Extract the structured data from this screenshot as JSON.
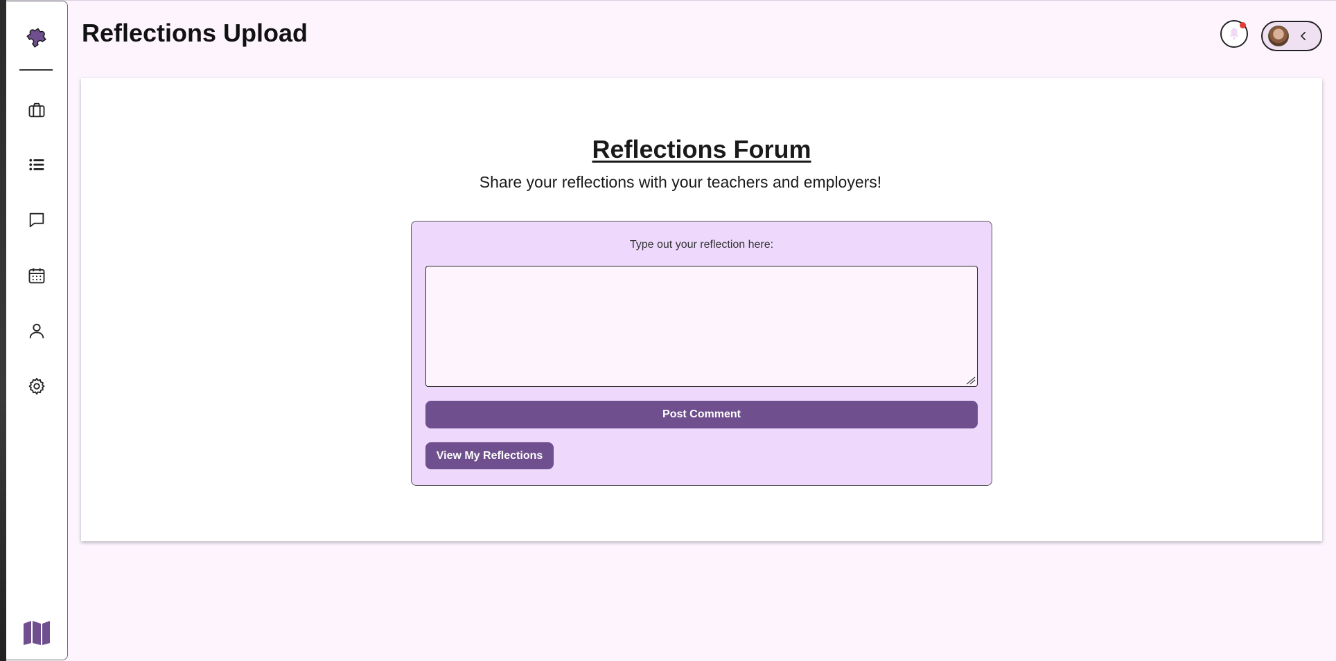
{
  "header": {
    "title": "Reflections Upload"
  },
  "sidebar": {
    "items": [
      {
        "name": "briefcase-icon"
      },
      {
        "name": "list-icon"
      },
      {
        "name": "chat-icon"
      },
      {
        "name": "calendar-icon"
      },
      {
        "name": "user-icon"
      },
      {
        "name": "gear-icon"
      }
    ],
    "accent_color": "#6f4f8d"
  },
  "notifications": {
    "has_unread": true,
    "dot_color": "#e53935"
  },
  "forum": {
    "title": "Reflections Forum",
    "subtitle": "Share your reflections with your teachers and employers!",
    "box_label": "Type out your reflection here:",
    "textarea_value": "",
    "post_label": "Post Comment",
    "view_label": "View My Reflections"
  },
  "colors": {
    "page_bg": "#fdf4fe",
    "box_bg": "#eed9fd",
    "button_bg": "#6f4f8d"
  }
}
